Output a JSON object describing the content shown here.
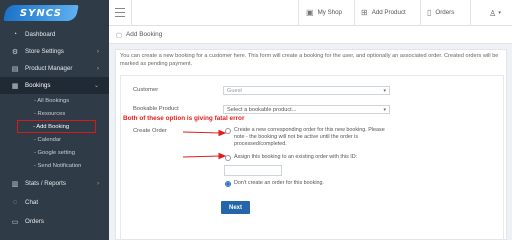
{
  "brand": {
    "logo_text": "SYNCS"
  },
  "sidebar": {
    "items": [
      {
        "label": "Dashboard",
        "icon": "dashboard-icon"
      },
      {
        "label": "Store Settings",
        "icon": "gear-icon"
      },
      {
        "label": "Product Manager",
        "icon": "cart-icon"
      },
      {
        "label": "Bookings",
        "icon": "calendar-icon"
      },
      {
        "label": "Stats / Reports",
        "icon": "chart-icon"
      },
      {
        "label": "Chat",
        "icon": "chat-icon"
      },
      {
        "label": "Orders",
        "icon": "orders-icon"
      }
    ],
    "sub_items": [
      "- All Bookings",
      "- Resources",
      "- Add Booking",
      "- Calendar",
      "- Google setting",
      "- Send Notification"
    ]
  },
  "topbar": {
    "my_shop": "My Shop",
    "add_product": "Add Product",
    "orders": "Orders"
  },
  "breadcrumb": {
    "title": "Add Booking"
  },
  "page": {
    "intro": "You can create a new booking for a customer here. This form will create a booking for the user, and optionally an associated order. Created orders will be marked as pending payment."
  },
  "form": {
    "customer_label": "Customer",
    "customer_placeholder": "Guest",
    "product_label": "Bookable Product",
    "product_value": "Select a bookable product...",
    "order_label": "Create Order",
    "option_new": "Create a new corresponding order for this new booking. Please note - the booking will not be active until the order is processed/completed.",
    "option_existing": "Assign this booking to an existing order with this ID:",
    "option_none": "Don't create an order for this booking.",
    "selected_option": "none",
    "next_label": "Next"
  },
  "annotation": {
    "text": "Both of these option is giving fatal error"
  },
  "colors": {
    "sidebar_bg": "#2f3b47",
    "highlight": "#d31b1b",
    "primary_button": "#2466a9",
    "annotation": "#e21d1d"
  }
}
